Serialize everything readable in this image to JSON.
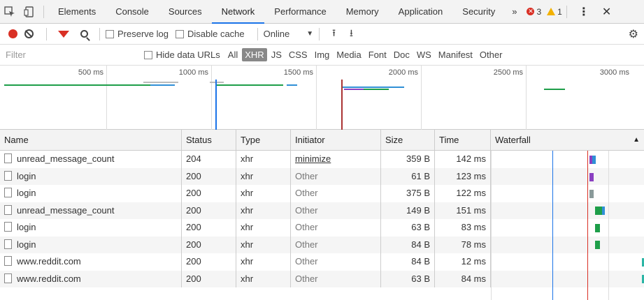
{
  "tabs": [
    {
      "label": "Elements"
    },
    {
      "label": "Console"
    },
    {
      "label": "Sources"
    },
    {
      "label": "Network",
      "active": true
    },
    {
      "label": "Performance"
    },
    {
      "label": "Memory"
    },
    {
      "label": "Application"
    },
    {
      "label": "Security"
    }
  ],
  "tabbar": {
    "more": "»",
    "errors": "3",
    "warnings": "1",
    "kebab": "⋮",
    "close": "✕"
  },
  "toolbar": {
    "preserve_log": "Preserve log",
    "disable_cache": "Disable cache",
    "throttle": "Online",
    "throttle_caret": "▼",
    "import": "⭱",
    "export": "⭳",
    "settings": "⚙"
  },
  "filterbar": {
    "placeholder": "Filter",
    "hide_data_urls": "Hide data URLs",
    "types": [
      "All",
      "XHR",
      "JS",
      "CSS",
      "Img",
      "Media",
      "Font",
      "Doc",
      "WS",
      "Manifest",
      "Other"
    ],
    "active_type": "XHR"
  },
  "overview": {
    "ticks": [
      "500 ms",
      "1000 ms",
      "1500 ms",
      "2000 ms",
      "2500 ms",
      "3000 ms"
    ]
  },
  "columns": [
    "Name",
    "Status",
    "Type",
    "Initiator",
    "Size",
    "Time",
    "Waterfall"
  ],
  "sort_indicator": "▲",
  "rows": [
    {
      "name": "unread_message_count",
      "status": "204",
      "type": "xhr",
      "initiator": "minimize",
      "initiator_link": true,
      "size": "359 B",
      "time": "142 ms"
    },
    {
      "name": "login",
      "status": "200",
      "type": "xhr",
      "initiator": "Other",
      "size": "61 B",
      "time": "123 ms"
    },
    {
      "name": "login",
      "status": "200",
      "type": "xhr",
      "initiator": "Other",
      "size": "375 B",
      "time": "122 ms"
    },
    {
      "name": "unread_message_count",
      "status": "200",
      "type": "xhr",
      "initiator": "Other",
      "size": "149 B",
      "time": "151 ms"
    },
    {
      "name": "login",
      "status": "200",
      "type": "xhr",
      "initiator": "Other",
      "size": "63 B",
      "time": "83 ms"
    },
    {
      "name": "login",
      "status": "200",
      "type": "xhr",
      "initiator": "Other",
      "size": "84 B",
      "time": "78 ms"
    },
    {
      "name": "www.reddit.com",
      "status": "200",
      "type": "xhr",
      "initiator": "Other",
      "size": "84 B",
      "time": "12 ms"
    },
    {
      "name": "www.reddit.com",
      "status": "200",
      "type": "xhr",
      "initiator": "Other",
      "size": "63 B",
      "time": "84 ms"
    }
  ],
  "colors": {
    "accent": "#1a73e8",
    "record": "#d93025",
    "warning": "#f2b100",
    "dom_line": "#1a73e8",
    "load_line": "#d93025"
  }
}
